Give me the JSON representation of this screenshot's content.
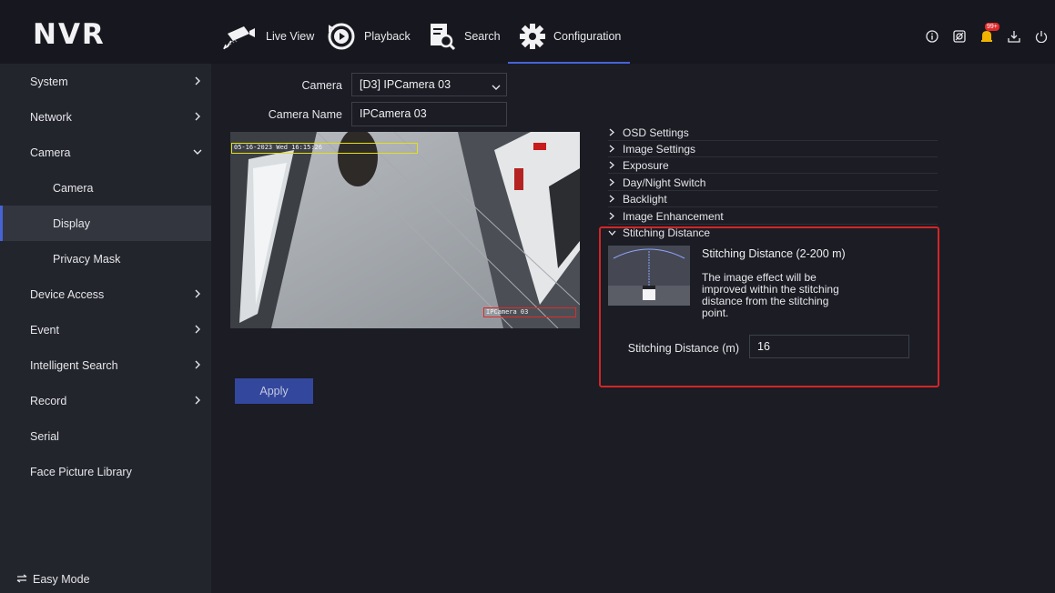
{
  "app": {
    "logo": "NVR",
    "nav": [
      {
        "label": "Live View",
        "icon": "camera-icon"
      },
      {
        "label": "Playback",
        "icon": "play-icon"
      },
      {
        "label": "Search",
        "icon": "search-file-icon"
      },
      {
        "label": "Configuration",
        "icon": "gear-icon"
      }
    ],
    "top_icons": [
      "info-icon",
      "record-icon",
      "alarm-bell-icon",
      "download-icon",
      "power-icon"
    ],
    "alarm_badge": "99+"
  },
  "sidebar": {
    "items": [
      {
        "label": "System"
      },
      {
        "label": "Network"
      },
      {
        "label": "Camera"
      },
      {
        "label": "Camera"
      },
      {
        "label": "Display"
      },
      {
        "label": "Privacy Mask"
      },
      {
        "label": "Device Access"
      },
      {
        "label": "Event"
      },
      {
        "label": "Intelligent Search"
      },
      {
        "label": "Record"
      },
      {
        "label": "Serial"
      },
      {
        "label": "Face Picture Library"
      }
    ],
    "easy_mode": "Easy Mode"
  },
  "form": {
    "camera_label": "Camera",
    "camera_value": "[D3] IPCamera 03",
    "name_label": "Camera Name",
    "name_value": "IPCamera 03",
    "apply": "Apply"
  },
  "preview": {
    "osd_datetime": "05-16-2023 Wed 16:15:26",
    "osd_name": "IPCamera 03"
  },
  "sections": [
    {
      "label": "OSD Settings"
    },
    {
      "label": "Image Settings"
    },
    {
      "label": "Exposure"
    },
    {
      "label": "Day/Night Switch"
    },
    {
      "label": "Backlight"
    },
    {
      "label": "Image Enhancement"
    },
    {
      "label": "Stitching Distance"
    }
  ],
  "stitching": {
    "title": "Stitching Distance (2-200 m)",
    "description": "The image effect will be improved within the stitching distance from the stitching point.",
    "field_label": "Stitching Distance (m)",
    "value": "16"
  },
  "colors": {
    "accent": "#4763d6",
    "highlight": "#d32626",
    "apply_bg": "#33479c"
  }
}
